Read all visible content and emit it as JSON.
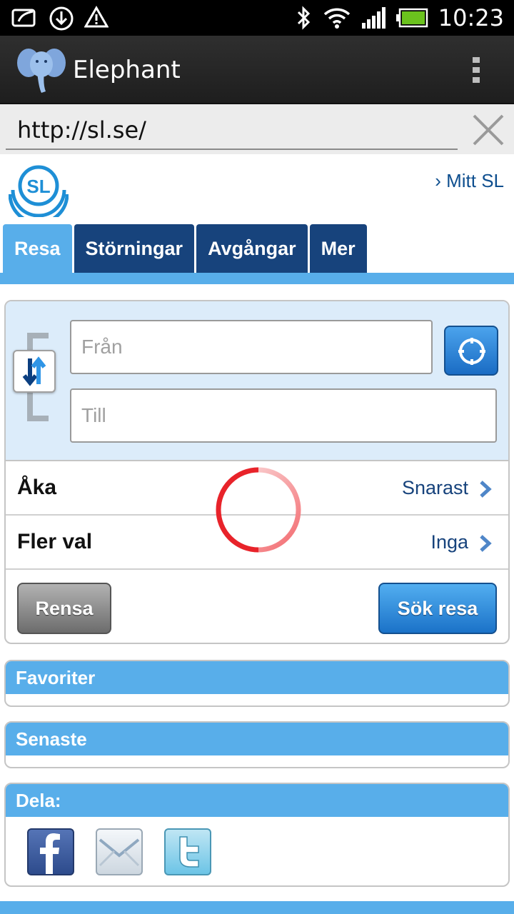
{
  "status_bar": {
    "time": "10:23",
    "icons": [
      "sync-icon",
      "download-icon",
      "warning-icon",
      "bluetooth-icon",
      "wifi-icon",
      "signal-icon",
      "battery-icon"
    ]
  },
  "app_bar": {
    "title": "Elephant",
    "logo_icon": "elephant-logo-icon",
    "menu_icon": "overflow-menu-icon"
  },
  "url_bar": {
    "value": "http://sl.se/",
    "clear_icon": "close-icon"
  },
  "site_header": {
    "logo_text": "SL",
    "account_link": "› Mitt SL"
  },
  "tabs": [
    {
      "label": "Resa",
      "active": true
    },
    {
      "label": "Störningar",
      "active": false
    },
    {
      "label": "Avgångar",
      "active": false
    },
    {
      "label": "Mer",
      "active": false
    }
  ],
  "trip_form": {
    "from_placeholder": "Från",
    "to_placeholder": "Till",
    "options": [
      {
        "label": "Åka",
        "value": "Snarast"
      },
      {
        "label": "Fler val",
        "value": "Inga"
      }
    ],
    "clear_label": "Rensa",
    "search_label": "Sök resa"
  },
  "panels": {
    "favorites": "Favoriter",
    "recent": "Senaste",
    "share": "Dela:"
  },
  "share_icons": [
    "facebook-icon",
    "mail-icon",
    "twitter-icon"
  ],
  "colors": {
    "accent": "#58aeea",
    "tab_dark": "#17437c",
    "link": "#17437c",
    "spinner": "#e8232a"
  }
}
